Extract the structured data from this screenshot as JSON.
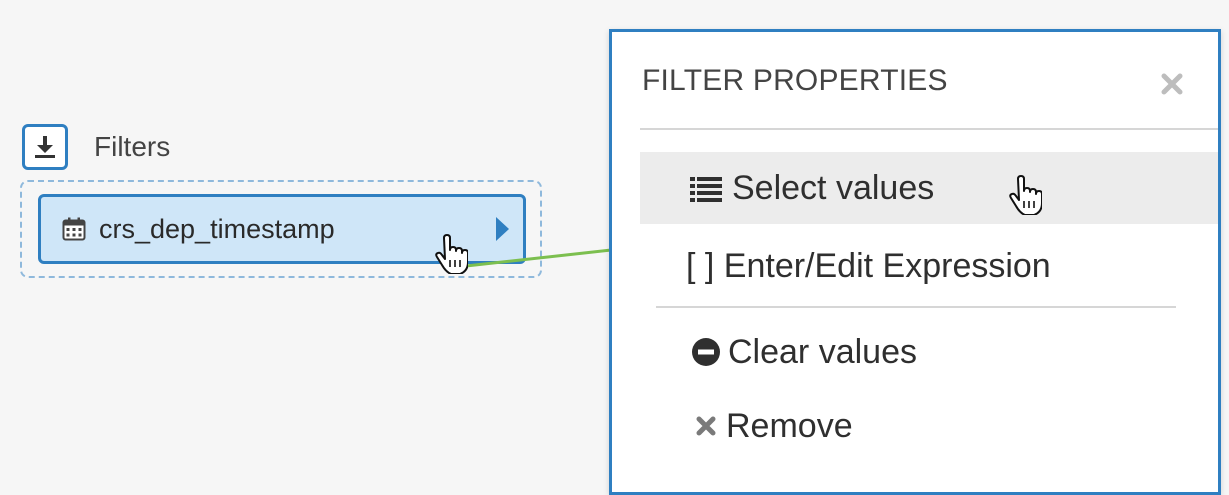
{
  "filters": {
    "label": "Filters",
    "download_icon": "download-icon",
    "pill": {
      "label": "crs_dep_timestamp",
      "type_icon": "calendar-icon",
      "menu_icon": "caret-right-icon"
    }
  },
  "panel": {
    "title": "FILTER PROPERTIES",
    "close_icon": "close-icon",
    "items": [
      {
        "label": "Select values",
        "icon": "list-icon",
        "highlighted": true
      },
      {
        "label": "[ ] Enter/Edit Expression",
        "icon": ""
      },
      {
        "label": "Clear values",
        "icon": "minus-circle-icon"
      },
      {
        "label": "Remove",
        "icon": "close-icon"
      }
    ]
  },
  "colors": {
    "accent": "#2f7fc1",
    "pill_background": "#cfe6f8",
    "connector_arrow": "#7cbf4f",
    "highlight_row": "#ececec"
  }
}
